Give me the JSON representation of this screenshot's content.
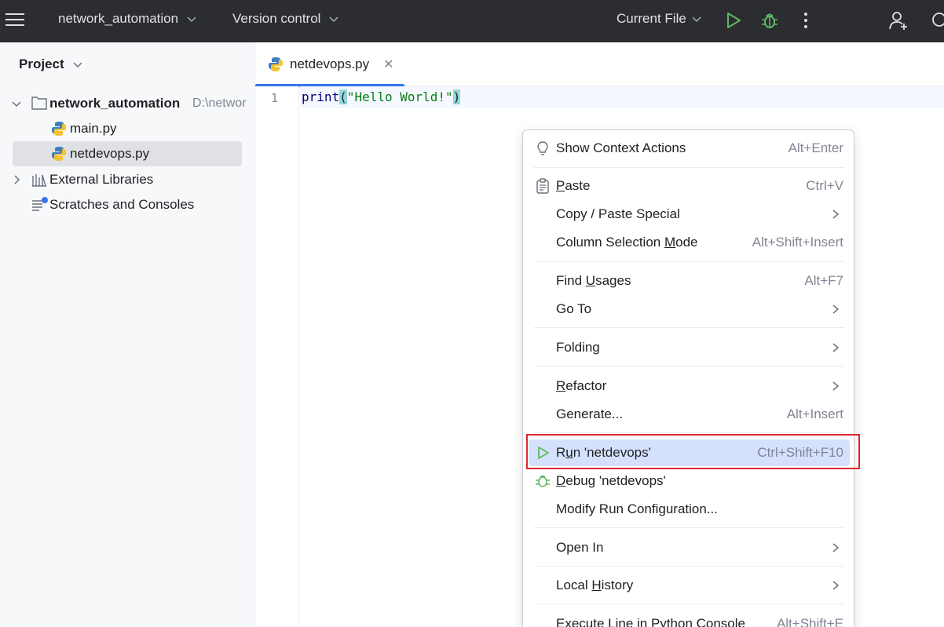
{
  "topbar": {
    "project_name": "network_automation",
    "vcs": "Version control",
    "run_config": "Current File"
  },
  "sidebar": {
    "title": "Project",
    "root": {
      "name": "network_automation",
      "path": "D:\\networ"
    },
    "files": [
      "main.py",
      "netdevops.py"
    ],
    "external_libraries": "External Libraries",
    "scratches": "Scratches and Consoles"
  },
  "editor": {
    "tab_name": "netdevops.py",
    "close_glyph": "✕",
    "line_number": "1",
    "code": {
      "fn": "print",
      "open_paren": "(",
      "string": "\"Hello World!\"",
      "close_paren": ")"
    }
  },
  "context_menu": {
    "items": [
      {
        "label": "Show Context Actions",
        "shortcut": "Alt+Enter",
        "icon": "lightbulb-icon"
      },
      {
        "pre": "",
        "mn": "P",
        "post": "aste",
        "shortcut": "Ctrl+V",
        "icon": "clipboard-icon"
      },
      {
        "label": "Copy / Paste Special",
        "submenu": true
      },
      {
        "pre": "Column Selection ",
        "mn": "M",
        "post": "ode",
        "shortcut": "Alt+Shift+Insert"
      },
      {
        "pre": "Find ",
        "mn": "U",
        "post": "sages",
        "shortcut": "Alt+F7"
      },
      {
        "label": "Go To",
        "submenu": true
      },
      {
        "label": "Folding",
        "submenu": true
      },
      {
        "pre": "",
        "mn": "R",
        "post": "efactor",
        "submenu": true
      },
      {
        "label": "Generate...",
        "shortcut": "Alt+Insert"
      },
      {
        "pre": "R",
        "mn": "u",
        "post": "n 'netdevops'",
        "shortcut": "Ctrl+Shift+F10",
        "icon": "run-icon",
        "highlighted": true
      },
      {
        "pre": "",
        "mn": "D",
        "post": "ebug 'netdevops'",
        "icon": "debug-icon"
      },
      {
        "label": "Modify Run Configuration..."
      },
      {
        "label": "Open In",
        "submenu": true
      },
      {
        "pre": "Local ",
        "mn": "H",
        "post": "istory",
        "submenu": true
      },
      {
        "label": "Execute Line in Python Console",
        "shortcut": "Alt+Shift+E"
      }
    ]
  },
  "colors": {
    "topbar_bg": "#2b2d30",
    "run_green": "#5fb865",
    "highlight": "#d5e1fc",
    "annotation_red": "#e0282e",
    "tab_accent": "#3574f0"
  }
}
